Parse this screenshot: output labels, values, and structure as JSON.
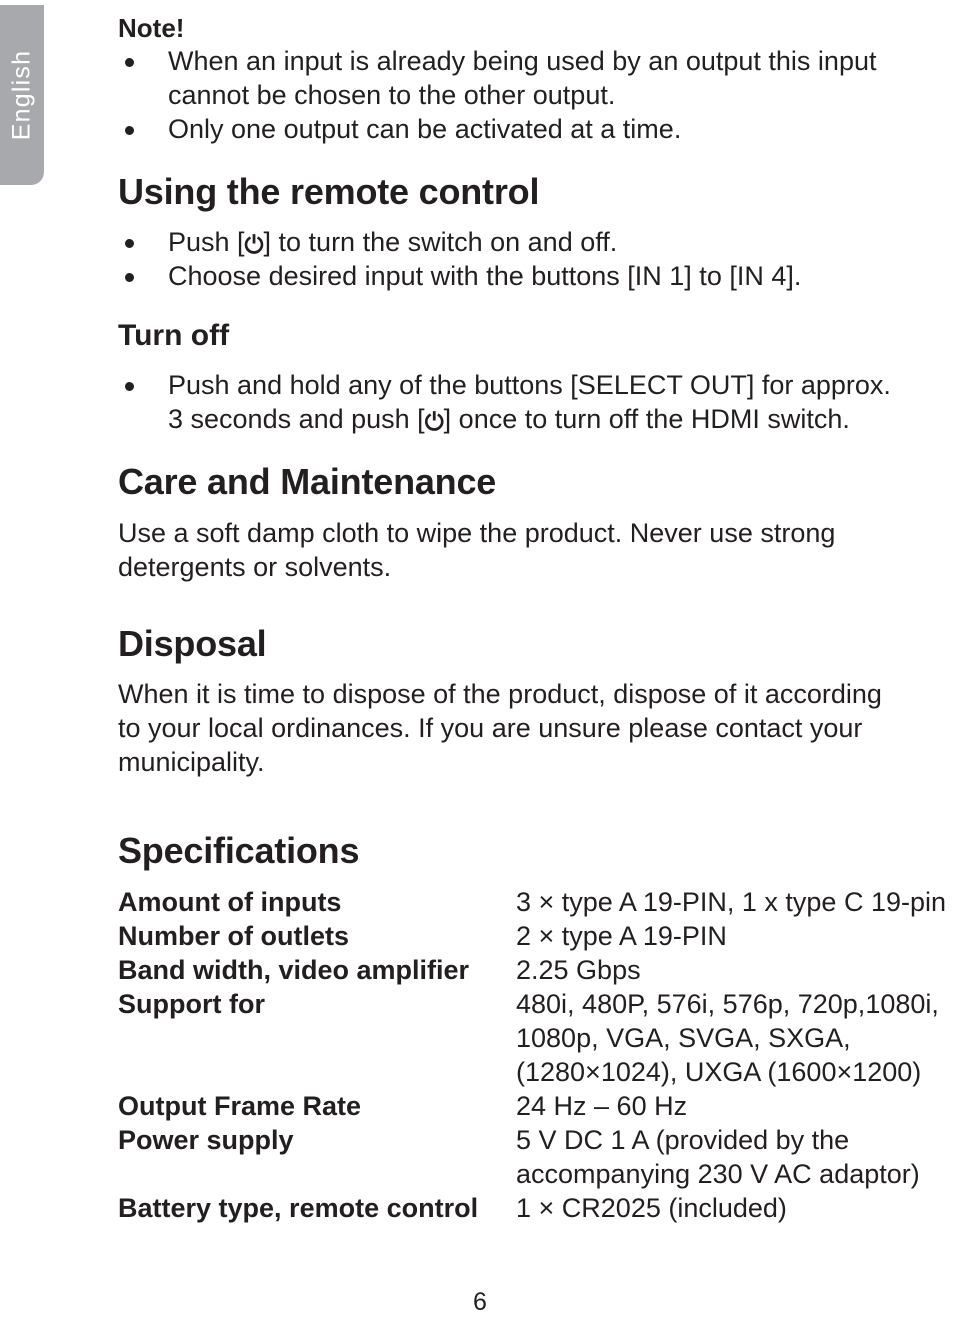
{
  "language_tab": {
    "label": "English",
    "background_color": "#a7a9ac",
    "text_color": "#ffffff"
  },
  "page": {
    "number": "6",
    "text_color": "#231f20",
    "background_color": "#ffffff"
  },
  "note": {
    "title": "Note!",
    "bullets": [
      "When an input is already being used by an output this input cannot be chosen to the other output.",
      "Only one output can be activated at a time."
    ]
  },
  "using_remote": {
    "title": "Using the remote control",
    "bullets": [
      {
        "before": "Push [",
        "icon": "⏻",
        "icon_name": "power-icon",
        "after": "] to turn the switch on and off."
      },
      {
        "before": "Choose desired input with the buttons [IN 1] to [IN 4].",
        "icon": "",
        "icon_name": "",
        "after": ""
      }
    ]
  },
  "turn_off": {
    "title": "Turn off",
    "bullet": {
      "before": "Push and hold any of the buttons [SELECT OUT] for approx. 3 seconds and push [",
      "icon": "⏻",
      "icon_name": "power-icon",
      "after": "] once to turn off the HDMI switch."
    }
  },
  "care": {
    "title": "Care and Maintenance",
    "body": "Use a soft damp cloth to wipe the product. Never use strong detergents or solvents."
  },
  "disposal": {
    "title": "Disposal",
    "body": "When it is time to dispose of the product, dispose of it according to your local ordinances. If you are unsure please contact your municipality."
  },
  "specifications": {
    "title": "Specifications",
    "rows": [
      {
        "label": "Amount of inputs",
        "value_lines": [
          "3 × type A 19-PIN, 1 x type C 19-pin"
        ]
      },
      {
        "label": "Number of outlets",
        "value_lines": [
          "2 × type A 19-PIN"
        ]
      },
      {
        "label": "Band width, video amplifier",
        "value_lines": [
          "2.25 Gbps"
        ]
      },
      {
        "label": "Support for",
        "value_lines": [
          "480i, 480P, 576i, 576p, 720p,1080i,",
          "1080p, VGA, SVGA, SXGA,",
          "(1280×1024), UXGA (1600×1200)"
        ]
      },
      {
        "label": "Output Frame Rate",
        "value_lines": [
          "24 Hz – 60 Hz"
        ]
      },
      {
        "label": "Power supply",
        "value_lines": [
          "5 V DC 1 A (provided by the",
          "accompanying 230 V AC adaptor)"
        ]
      },
      {
        "label": "Battery type, remote control",
        "value_lines": [
          "1 × CR2025 (included)"
        ]
      }
    ]
  }
}
